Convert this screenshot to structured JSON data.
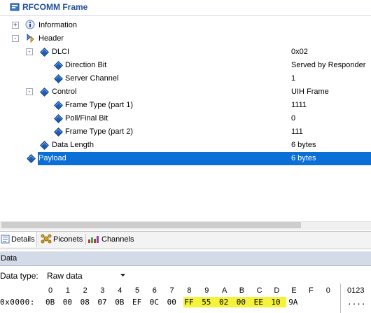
{
  "title": "RFCOMM Frame",
  "tree": [
    {
      "label": "Information",
      "value": "",
      "expander": "+",
      "icon": "information-icon"
    },
    {
      "label": "Header",
      "value": "",
      "expander": "-",
      "icon": "header-icon"
    },
    {
      "label": "DLCI",
      "value": "0x02",
      "expander": "-",
      "icon": "field-diamond-icon"
    },
    {
      "label": "Direction Bit",
      "value": "Served by Responder",
      "expander": "",
      "icon": "field-diamond-icon"
    },
    {
      "label": "Server Channel",
      "value": "1",
      "expander": "",
      "icon": "field-diamond-icon"
    },
    {
      "label": "Control",
      "value": "UIH Frame",
      "expander": "-",
      "icon": "field-diamond-icon"
    },
    {
      "label": "Frame Type (part 1)",
      "value": "1111",
      "expander": "",
      "icon": "field-diamond-icon"
    },
    {
      "label": "Poll/Final Bit",
      "value": "0",
      "expander": "",
      "icon": "field-diamond-icon"
    },
    {
      "label": "Frame Type (part 2)",
      "value": "111",
      "expander": "",
      "icon": "field-diamond-icon"
    },
    {
      "label": "Data Length",
      "value": "6 bytes",
      "expander": "",
      "icon": "field-diamond-icon"
    },
    {
      "label": "Payload",
      "value": "6 bytes",
      "expander": "",
      "icon": "field-diamond-icon",
      "selected": true
    }
  ],
  "tabs": [
    {
      "label": "Details",
      "icon": "details-icon",
      "active": true
    },
    {
      "label": "Piconets",
      "icon": "piconets-icon",
      "active": false
    },
    {
      "label": "Channels",
      "icon": "channels-icon",
      "active": false
    }
  ],
  "data_panel": {
    "title": "Data",
    "data_type_label": "Data type:",
    "data_type_value": "Raw data"
  },
  "hex": {
    "column_headers": [
      "0",
      "1",
      "2",
      "3",
      "4",
      "5",
      "6",
      "7",
      "8",
      "9",
      "A",
      "B",
      "C",
      "D",
      "E",
      "F",
      "0"
    ],
    "ascii_header": "0123",
    "offset": "0x0000:",
    "bytes": [
      "0B",
      "00",
      "08",
      "07",
      "0B",
      "EF",
      "0C",
      "00",
      "FF",
      "55",
      "02",
      "00",
      "EE",
      "10",
      "9A"
    ],
    "highlighted_from": 8,
    "highlighted_to": 13,
    "ascii": "...."
  },
  "colors": {
    "selection": "#0a6fd6",
    "title": "#1f4e9a",
    "highlight": "#f4f23a",
    "data_header": "#d4dbe8"
  }
}
